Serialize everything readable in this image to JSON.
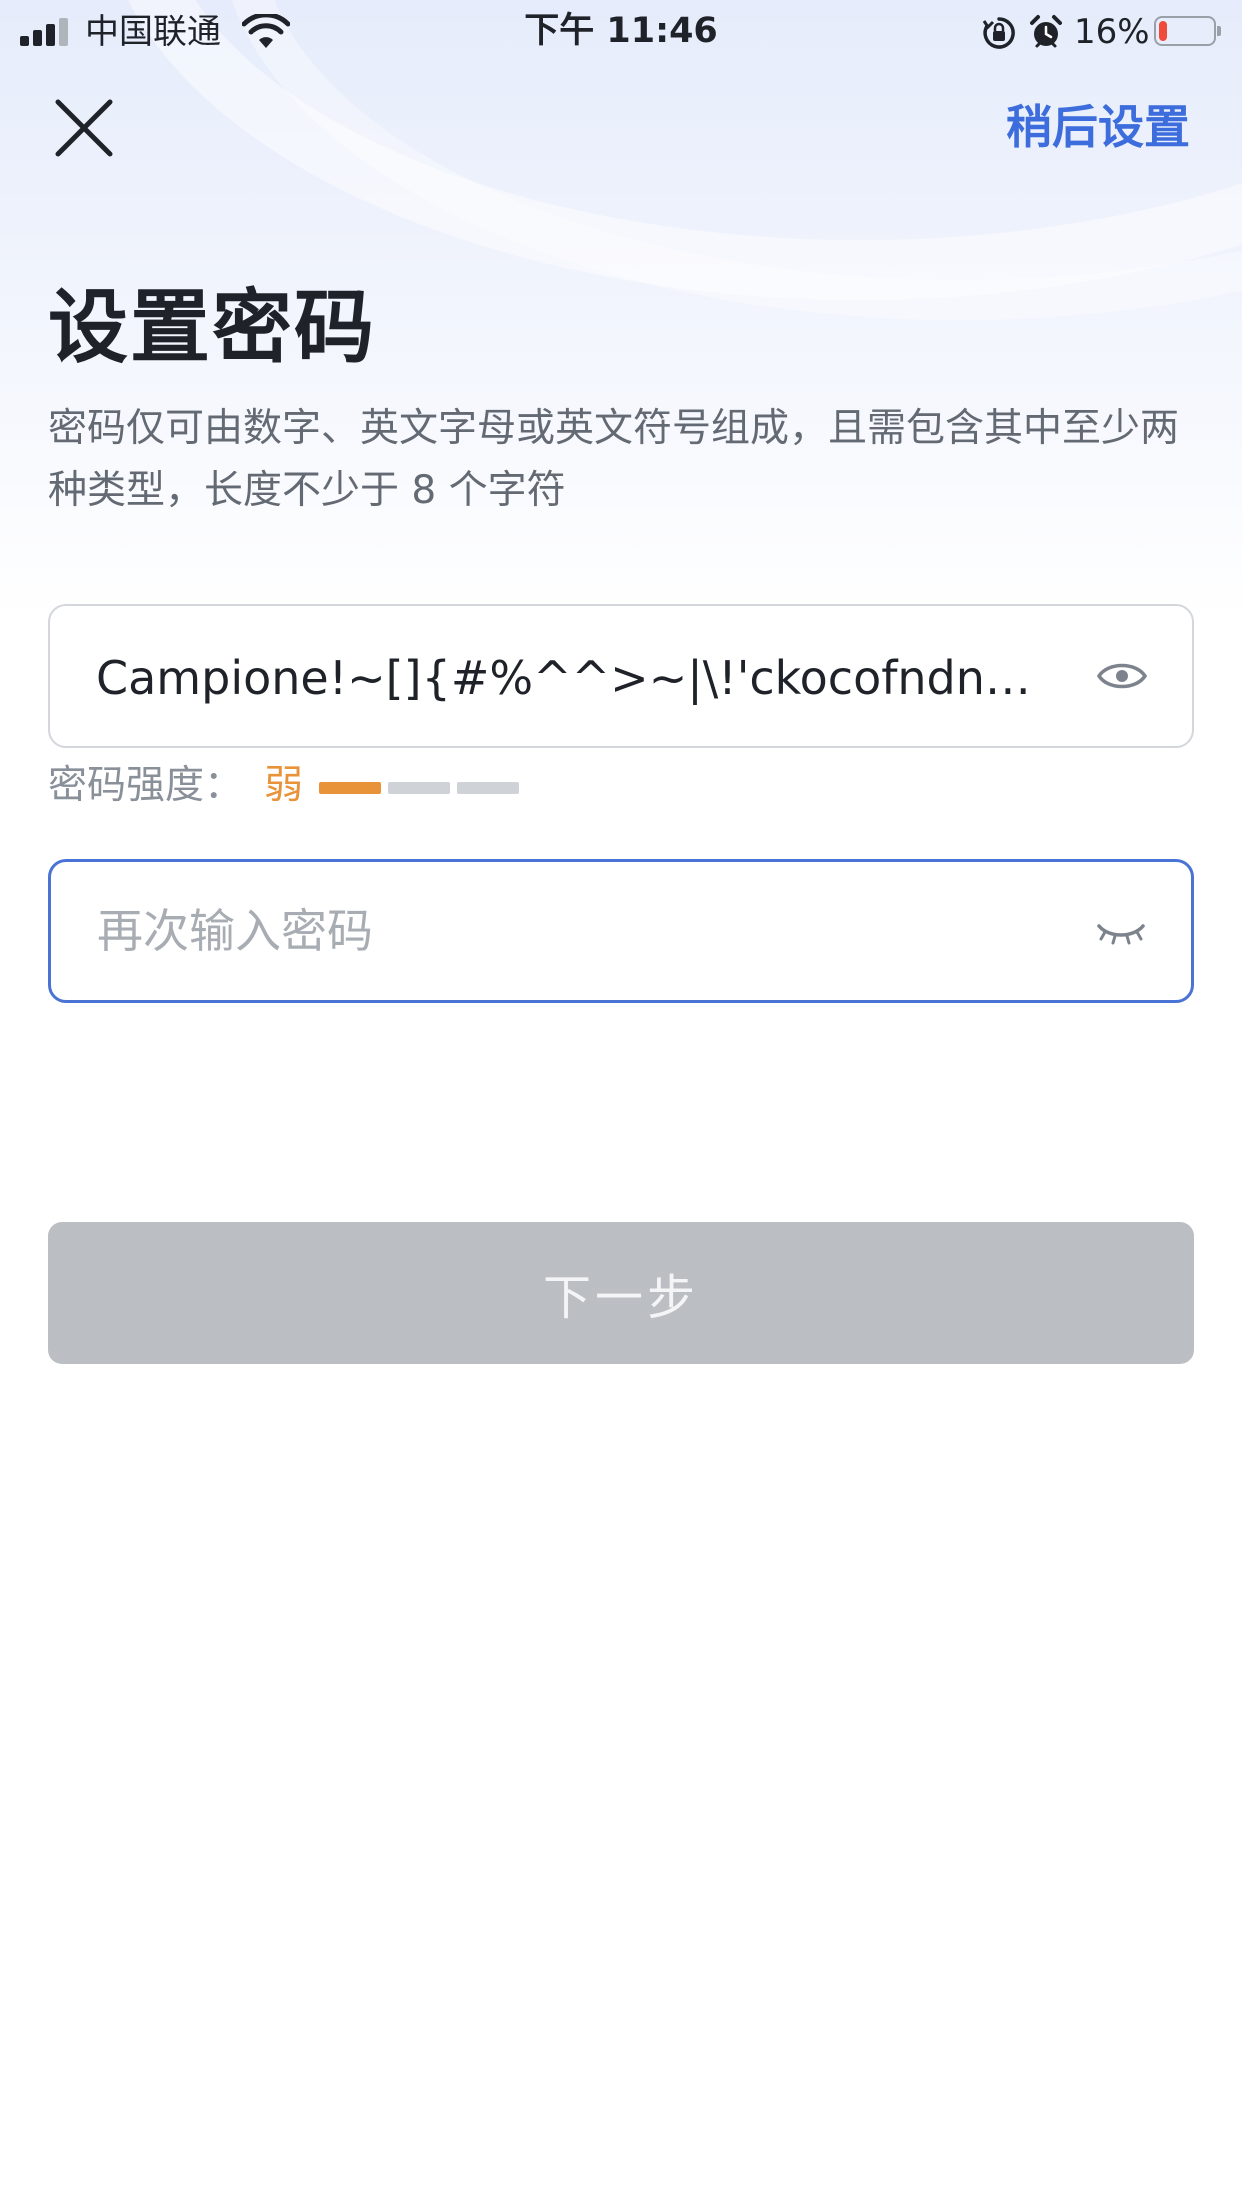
{
  "status_bar": {
    "carrier": "中国联通",
    "time": "下午 11:46",
    "battery_percent": "16%",
    "battery_level": 0.16,
    "signal_bars_active": 3,
    "signal_bars_total": 4,
    "icons": [
      "signal-icon",
      "wifi-icon",
      "rotation-lock-icon",
      "alarm-icon",
      "battery-icon"
    ]
  },
  "nav": {
    "close_icon": "close-icon",
    "later_label": "稍后设置"
  },
  "header": {
    "title": "设置密码",
    "description": "密码仅可由数字、英文字母或英文符号组成，且需包含其中至少两种类型，长度不少于 8 个字符"
  },
  "password_field": {
    "value": "Campione!~[]{#%^^>~|\\!'ckocofndnhaikeqwj",
    "visibility_icon": "eye-open-icon"
  },
  "strength": {
    "label": "密码强度：",
    "value": "弱",
    "level": 1,
    "segments": 3,
    "active_color": "#e8923a",
    "inactive_color": "#cfd2d7"
  },
  "confirm_field": {
    "value": "",
    "placeholder": "再次输入密码",
    "visibility_icon": "eye-closed-icon"
  },
  "actions": {
    "next_label": "下一步",
    "next_enabled": false
  },
  "colors": {
    "accent": "#3d6ddc",
    "focus_border": "#4a73d6",
    "disabled_button": "#bbbec3"
  }
}
